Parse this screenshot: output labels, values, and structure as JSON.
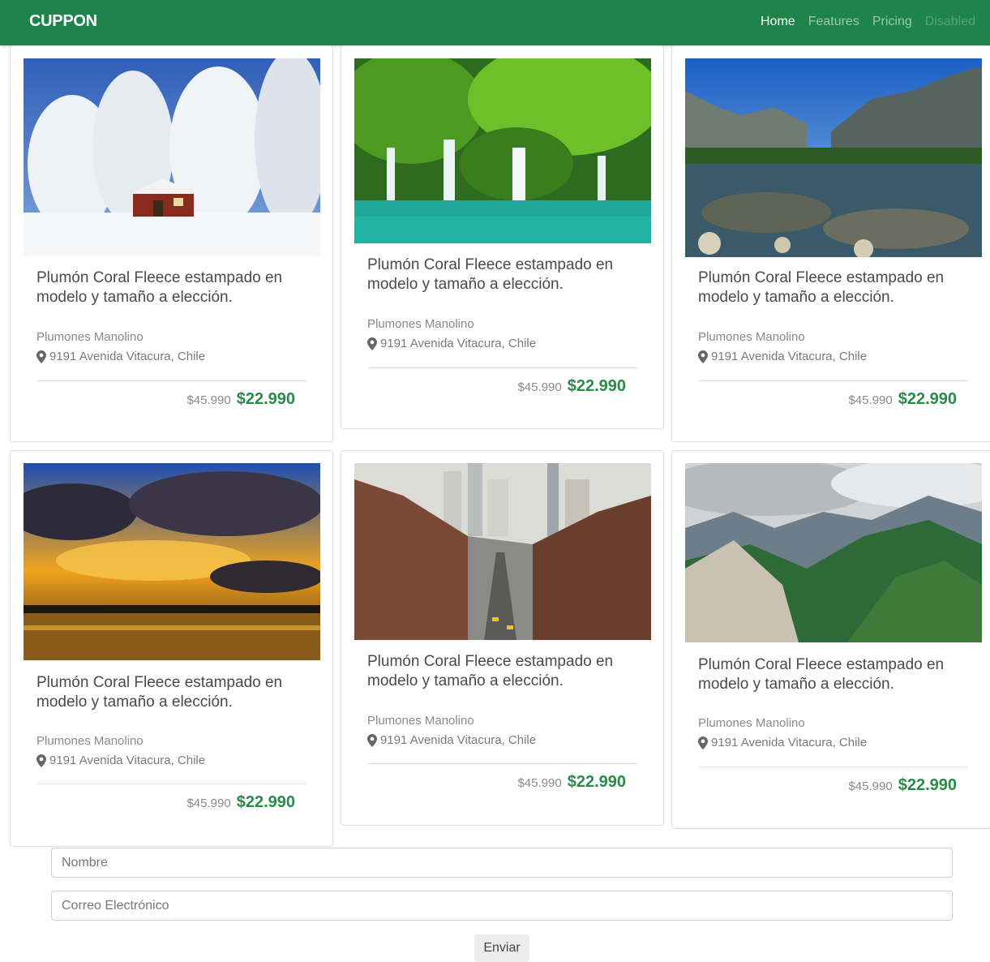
{
  "navbar": {
    "brand": "CUPPON",
    "links": [
      "Home",
      "Features",
      "Pricing",
      "Disabled"
    ]
  },
  "deals": [
    {
      "image": "snowy-cabin-forest",
      "title": "Plumón Coral Fleece estampado en modelo y tamaño a elección.",
      "seller": "Plumones Manolino",
      "address": "9191 Avenida Vitacura, Chile",
      "old_price": "$45.990",
      "new_price": "$22.990"
    },
    {
      "image": "jungle-waterfall",
      "title": "Plumón Coral Fleece estampado en modelo y tamaño a elección.",
      "seller": "Plumones Manolino",
      "address": "9191 Avenida Vitacura, Chile",
      "old_price": "$45.990",
      "new_price": "$22.990"
    },
    {
      "image": "mountain-river-valley",
      "title": "Plumón Coral Fleece estampado en modelo y tamaño a elección.",
      "seller": "Plumones Manolino",
      "address": "9191 Avenida Vitacura, Chile",
      "old_price": "$45.990",
      "new_price": "$22.990"
    },
    {
      "image": "sunset-over-lake",
      "title": "Plumón Coral Fleece estampado en modelo y tamaño a elección.",
      "seller": "Plumones Manolino",
      "address": "9191 Avenida Vitacura, Chile",
      "old_price": "$45.990",
      "new_price": "$22.990"
    },
    {
      "image": "city-street-skyline",
      "title": "Plumón Coral Fleece estampado en modelo y tamaño a elección.",
      "seller": "Plumones Manolino",
      "address": "9191 Avenida Vitacura, Chile",
      "old_price": "$45.990",
      "new_price": "$22.990"
    },
    {
      "image": "green-mountain-range",
      "title": "Plumón Coral Fleece estampado en modelo y tamaño a elección.",
      "seller": "Plumones Manolino",
      "address": "9191 Avenida Vitacura, Chile",
      "old_price": "$45.990",
      "new_price": "$22.990"
    }
  ],
  "form": {
    "name_placeholder": "Nombre",
    "email_placeholder": "Correo Electrónico",
    "submit_label": "Enviar"
  },
  "colors": {
    "brand_green": "#1e8449",
    "price_green": "#2a8a4a"
  }
}
